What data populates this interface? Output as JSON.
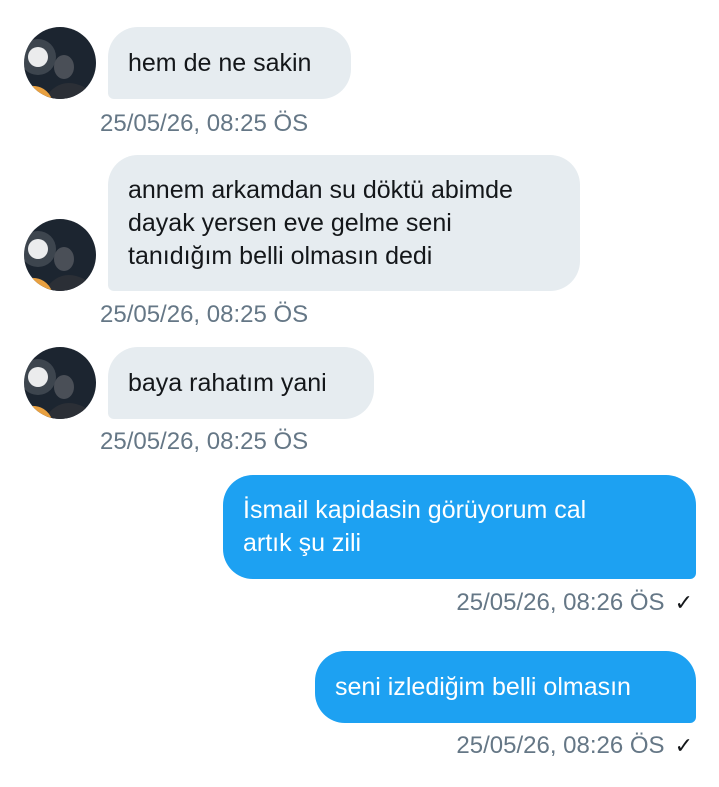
{
  "colors": {
    "incoming_bubble": "#e6ecf0",
    "outgoing_bubble": "#1da1f2",
    "timestamp": "#657786",
    "incoming_text": "#14171a",
    "outgoing_text": "#ffffff"
  },
  "messages": [
    {
      "direction": "incoming",
      "lines": [
        "hem de ne sakin"
      ],
      "timestamp": "25/05/26, 08:25 ÖS"
    },
    {
      "direction": "incoming",
      "lines": [
        "annem arkamdan su döktü abimde",
        "dayak yersen eve gelme seni",
        "tanıdığım belli olmasın dedi"
      ],
      "timestamp": "25/05/26, 08:25 ÖS"
    },
    {
      "direction": "incoming",
      "lines": [
        "baya rahatım yani"
      ],
      "timestamp": "25/05/26, 08:25 ÖS"
    },
    {
      "direction": "outgoing",
      "lines": [
        "İsmail kapidasin görüyorum cal",
        "artık şu zili"
      ],
      "timestamp": "25/05/26, 08:26 ÖS",
      "status_icon": "check-icon",
      "status_glyph": "✓"
    },
    {
      "direction": "outgoing",
      "lines": [
        "seni izlediğim belli olmasın"
      ],
      "timestamp": "25/05/26, 08:26 ÖS",
      "status_icon": "check-icon",
      "status_glyph": "✓"
    }
  ]
}
